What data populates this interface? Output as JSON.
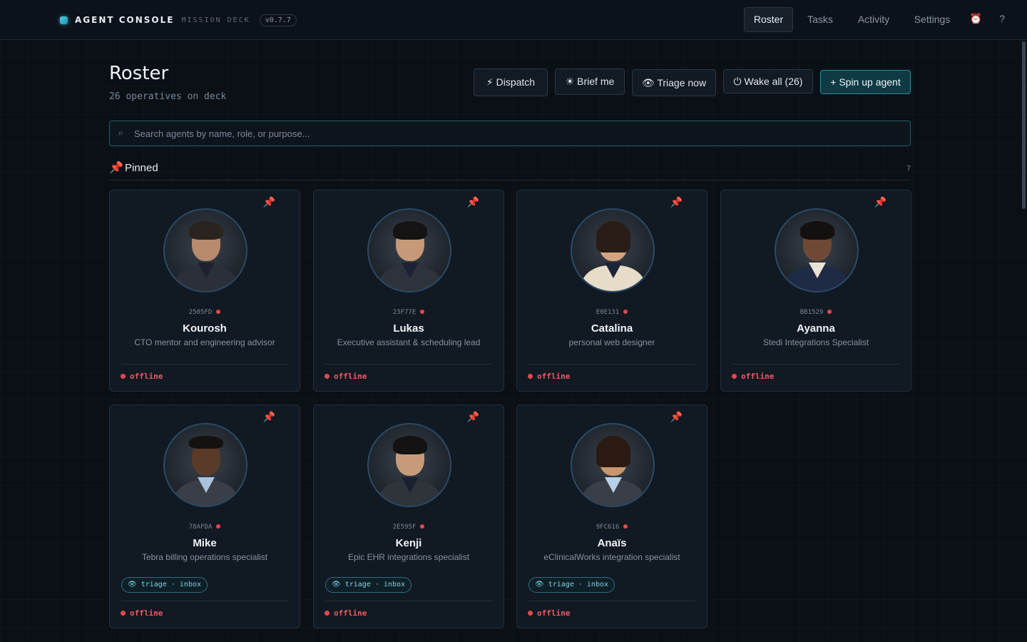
{
  "header": {
    "brand_title": "AGENT CONSOLE",
    "brand_subtitle": "MISSION DECK",
    "version": "v0.7.7",
    "nav": [
      "Roster",
      "Tasks",
      "Activity",
      "Settings"
    ],
    "active_tab": "Roster",
    "alarm_icon": "⏰",
    "help_icon": "?"
  },
  "page": {
    "title": "Roster",
    "subtitle": "26 operatives on deck"
  },
  "actions": {
    "dispatch": "⚡ Dispatch",
    "brief": "☀ Brief me",
    "triage": "👁 Triage now",
    "wake": "⏻ Wake all (26)",
    "spin_up": "+ Spin up agent"
  },
  "search": {
    "icon": "⌕",
    "placeholder": "Search agents by name, role, or purpose..."
  },
  "section": {
    "icon": "📌",
    "title": "Pinned",
    "count": "7"
  },
  "agents": [
    {
      "id": "2505FD",
      "name": "Kourosh",
      "role": "CTO mentor and engineering advisor",
      "status": "offline",
      "tag": null,
      "pin": "📌"
    },
    {
      "id": "23F77E",
      "name": "Lukas",
      "role": "Executive assistant & scheduling lead",
      "status": "offline",
      "tag": null,
      "pin": "📌"
    },
    {
      "id": "E0E131",
      "name": "Catalina",
      "role": "personal web designer",
      "status": "offline",
      "tag": null,
      "pin": "📌"
    },
    {
      "id": "BB1529",
      "name": "Ayanna",
      "role": "Stedi Integrations Specialist",
      "status": "offline",
      "tag": null,
      "pin": "📌"
    },
    {
      "id": "78AFDA",
      "name": "Mike",
      "role": "Tebra billing operations specialist",
      "status": "offline",
      "tag": "👁 triage · inbox",
      "pin": "📌"
    },
    {
      "id": "2E595F",
      "name": "Kenji",
      "role": "Epic EHR integrations specialist",
      "status": "offline",
      "tag": "👁 triage · inbox",
      "pin": "📌"
    },
    {
      "id": "9FC616",
      "name": "Anaïs",
      "role": "eClinicalWorks integration specialist",
      "status": "offline",
      "tag": "👁 triage · inbox",
      "pin": "📌"
    }
  ]
}
